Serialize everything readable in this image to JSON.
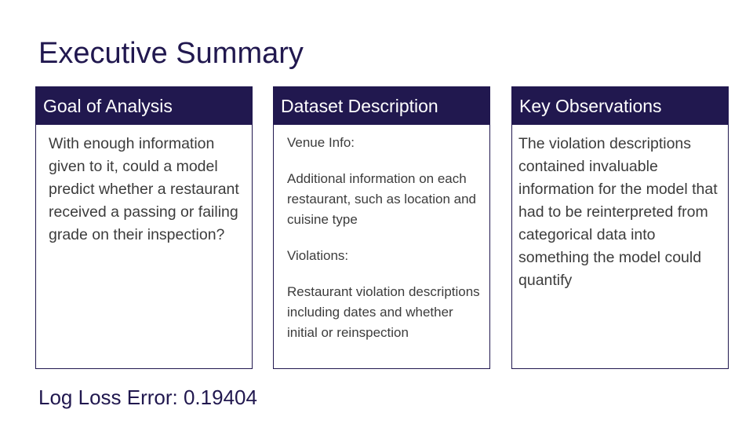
{
  "title": "Executive Summary",
  "cards": [
    {
      "header": "Goal of Analysis",
      "paragraphs": [
        "With enough information given to it, could a model predict whether a restaurant received a passing or failing grade on their inspection?"
      ]
    },
    {
      "header": "Dataset Description",
      "paragraphs": [
        "Venue Info:",
        "Additional information on each restaurant, such as location and cuisine type",
        "Violations:",
        "Restaurant violation descriptions including dates and whether initial or reinspection"
      ]
    },
    {
      "header": "Key Observations",
      "paragraphs": [
        "The violation descriptions contained invaluable information for the model that had to be reinterpreted from categorical data into something the model could quantify"
      ]
    }
  ],
  "footer": {
    "log_loss": "Log Loss Error: 0.19404"
  },
  "colors": {
    "primary": "#21184f",
    "body_text": "#3c3c3c",
    "background": "#ffffff"
  }
}
